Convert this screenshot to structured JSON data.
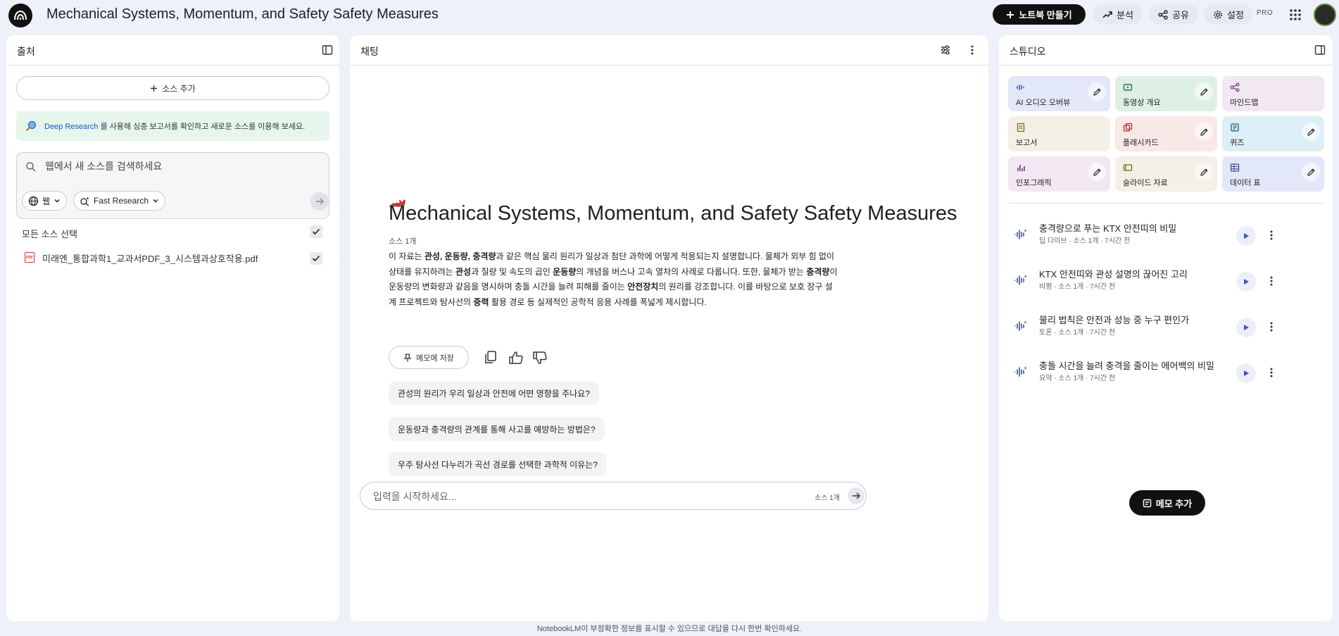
{
  "header": {
    "notebook_title": "Mechanical Systems, Momentum, and Safety Safety Measures",
    "new_notebook_label": "노트북 만들기",
    "analysis_label": "분석",
    "share_label": "공유",
    "settings_label": "설정",
    "pro_badge": "PRO"
  },
  "sources": {
    "title": "출처",
    "add_source_label": "소스 추가",
    "deep_research": {
      "link": "Deep Research",
      "text": "를 사용해 심층 보고서를 확인하고 새로운 소스를 이용해 보세요."
    },
    "search": {
      "placeholder": "웹에서 새 소스를 검색하세요",
      "web_chip": "웹",
      "mode_chip": "Fast Research"
    },
    "select_all_label": "모든 소스 선택",
    "items": [
      {
        "name": "미래엔_통합과학1_교과서PDF_3_시스템과상호작용.pdf",
        "checked": true
      }
    ]
  },
  "chat": {
    "title": "채팅",
    "emoji": "🏎️",
    "heading": "Mechanical Systems, Momentum, and Safety Safety Measures",
    "source_count": "소스 1개",
    "summary": {
      "p01": "이 자료는 ",
      "b01": "관성, 운동량, 충격량",
      "p02": "과 같은 핵심 물리 원리가 일상과 첨단 과학에 어떻게 적용되는지 설명합니다. 물체가 외부 힘 없이 상태를 유지하려는 ",
      "b02": "관성",
      "p03": "과 질량 및 속도의 곱인 ",
      "b03": "운동량",
      "p04": "의 개념을 버스나 고속 열차의 사례로 다룹니다. 또한, 물체가 받는 ",
      "b04": "충격량",
      "p05": "이 운동량의 변화량과 같음을 명시하며 충돌 시간을 늘려 피해를 줄이는 ",
      "b05": "안전장치",
      "p06": "의 원리를 강조합니다. 이를 바탕으로 보호 장구 설계 프로젝트와 탐사선의 ",
      "b06": "중력",
      "p07": " 활용 경로 등 실제적인 공학적 응용 사례를 폭넓게 제시합니다."
    },
    "save_memo_label": "메모에 저장",
    "suggestions": [
      "관성의 원리가 우리 일상과 안전에 어떤 영향을 주나요?",
      "운동량과 충격량의 관계를 통해 사고를 예방하는 방법은?",
      "우주 탐사선 다누리가 곡선 경로를 선택한 과학적 이유는?"
    ],
    "input": {
      "placeholder": "입력을 시작하세요...",
      "source_count": "소스 1개"
    }
  },
  "studio": {
    "title": "스튜디오",
    "tiles": [
      {
        "label": "AI 오디오 오버뷰",
        "icon": "audio-wave-icon",
        "color": "#e3e8f8",
        "editable": true
      },
      {
        "label": "동영상 개요",
        "icon": "video-icon",
        "color": "#def0e4",
        "editable": true
      },
      {
        "label": "마인드맵",
        "icon": "mindmap-icon",
        "color": "#f1e8f1",
        "editable": false
      },
      {
        "label": "보고서",
        "icon": "report-icon",
        "color": "#f3f0e6",
        "editable": false
      },
      {
        "label": "플래시카드",
        "icon": "flashcard-icon",
        "color": "#f8e8e6",
        "editable": true
      },
      {
        "label": "퀴즈",
        "icon": "quiz-icon",
        "color": "#ddeff6",
        "editable": true
      },
      {
        "label": "인포그래픽",
        "icon": "infographic-icon",
        "color": "#f1e8f1",
        "editable": true
      },
      {
        "label": "슬라이드 자료",
        "icon": "slides-icon",
        "color": "#f3f0e6",
        "editable": true
      },
      {
        "label": "데이터 표",
        "icon": "data-table-icon",
        "color": "#e3e8f8",
        "editable": true
      }
    ],
    "audio_items": [
      {
        "title": "충격량으로 푸는 KTX 안전띠의 비밀",
        "meta": "딥 다이브 · 소스 1개 · 7시간 전"
      },
      {
        "title": "KTX 안전띠와 관성 설명의 끊어진 고리",
        "meta": "비평 · 소스 1개 · 7시간 전"
      },
      {
        "title": "물리 법칙은 안전과 성능 중 누구 편인가",
        "meta": "토론 · 소스 1개 · 7시간 전"
      },
      {
        "title": "충돌 시간을 늘려 충격을 줄이는 에어백의 비밀",
        "meta": "요약 · 소스 1개 · 7시간 전"
      }
    ],
    "add_memo_label": "메모 추가"
  },
  "footer": {
    "disclaimer": "NotebookLM이 부정확한 정보를 표시할 수 있으므로 대답을 다시 한번 확인하세요."
  }
}
